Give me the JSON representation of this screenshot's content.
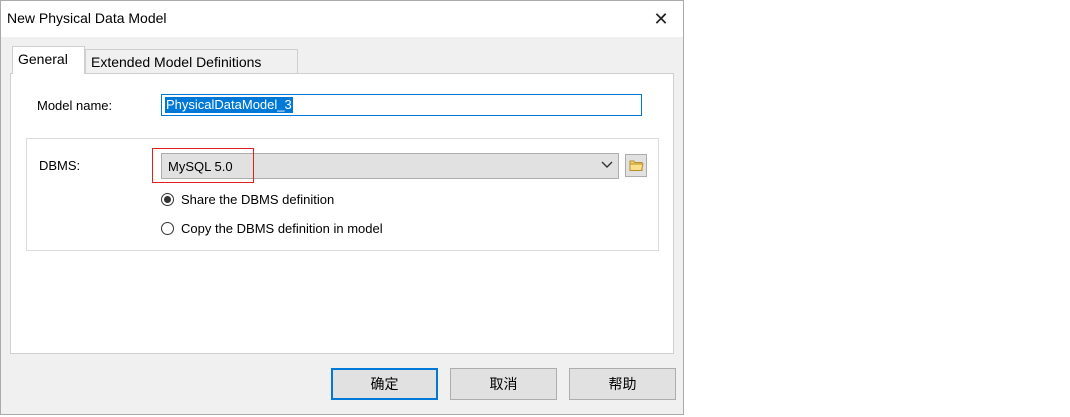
{
  "window": {
    "title": "New Physical Data Model",
    "close_glyph": "✕"
  },
  "tabs": [
    {
      "label": "General",
      "active": true
    },
    {
      "label": "Extended Model Definitions",
      "active": false
    }
  ],
  "general": {
    "model_name_label": "Model name:",
    "model_name_value": "PhysicalDataModel_3",
    "dbms_label": "DBMS:",
    "dbms_value": "MySQL 5.0",
    "dbms_dropdown_icon": "chevron-down-icon",
    "browse_icon": "folder-icon",
    "options": [
      {
        "label": "Share the DBMS definition",
        "selected": true
      },
      {
        "label": "Copy the DBMS definition in model",
        "selected": false
      }
    ]
  },
  "buttons": {
    "ok": "确定",
    "cancel": "取消",
    "help": "帮助"
  },
  "colors": {
    "accent": "#0078d7",
    "highlight_box": "#e02020",
    "dialog_bg": "#f0f0f0"
  }
}
